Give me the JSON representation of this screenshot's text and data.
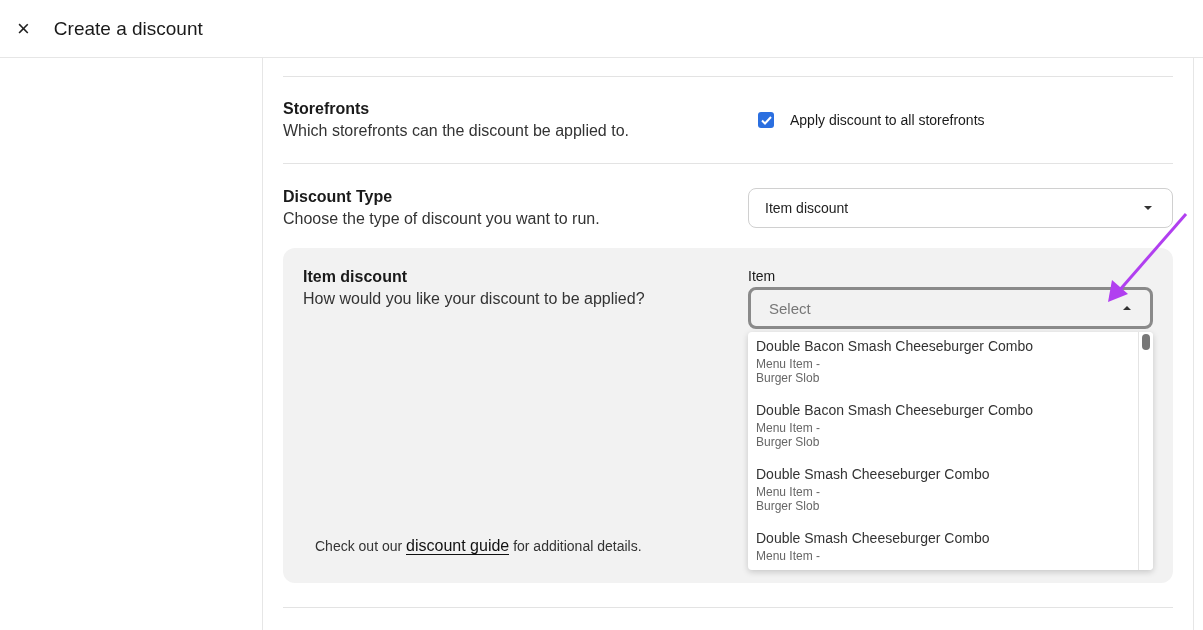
{
  "header": {
    "close": "×",
    "title": "Create a discount"
  },
  "storefronts": {
    "title": "Storefronts",
    "description": "Which storefronts can the discount be applied to.",
    "checkbox": {
      "label": "Apply discount to all storefronts",
      "checked": true
    }
  },
  "discount_type": {
    "title": "Discount Type",
    "description": "Choose the type of discount you want to run.",
    "value": "Item discount"
  },
  "item_discount": {
    "title": "Item discount",
    "description": "How would you like your discount to be applied?",
    "footnote": {
      "before": "Check out our",
      "link": "discount guide",
      "after": "for additional details."
    },
    "item_field": {
      "label": "Item",
      "placeholder": "Select",
      "expanded": true,
      "options": [
        {
          "name": "Double Bacon Smash Cheeseburger Combo",
          "lines": [
            "Menu Item -",
            "Burger Slob"
          ]
        },
        {
          "name": "Double Bacon Smash Cheeseburger Combo",
          "lines": [
            "Menu Item -",
            "Burger Slob"
          ]
        },
        {
          "name": "Double Smash Cheeseburger Combo",
          "lines": [
            "Menu Item -",
            "Burger Slob"
          ]
        },
        {
          "name": "Double Smash Cheeseburger Combo",
          "lines": [
            "Menu Item -"
          ]
        }
      ]
    }
  }
}
